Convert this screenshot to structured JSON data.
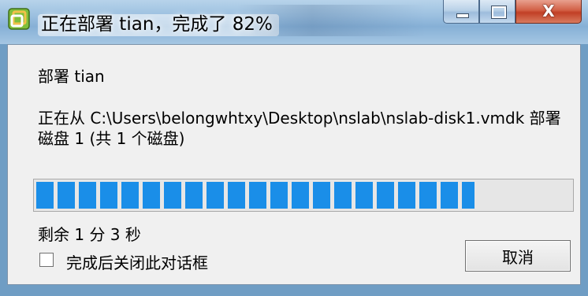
{
  "window": {
    "title": "正在部署 tian，完成了 82%",
    "icon": "vsphere-app-icon",
    "controls": {
      "minimize": "minimize-icon",
      "maximize": "maximize-icon",
      "close_glyph": "X"
    }
  },
  "content": {
    "deploy_title": "部署 tian",
    "status": "正在从 C:\\Users\\belongwhtxy\\Desktop\\nslab\\nslab-disk1.vmdk 部署磁盘 1 (共 1 个磁盘)",
    "progress_percent": 82,
    "time_remaining": "剩余 1 分 3 秒",
    "close_checkbox": {
      "label": "完成后关闭此对话框",
      "checked": false
    },
    "cancel_label": "取消"
  },
  "colors": {
    "progress_fill": "#1a8ee8",
    "titlebar": "#9cc0e0",
    "close_button": "#c13f25"
  }
}
